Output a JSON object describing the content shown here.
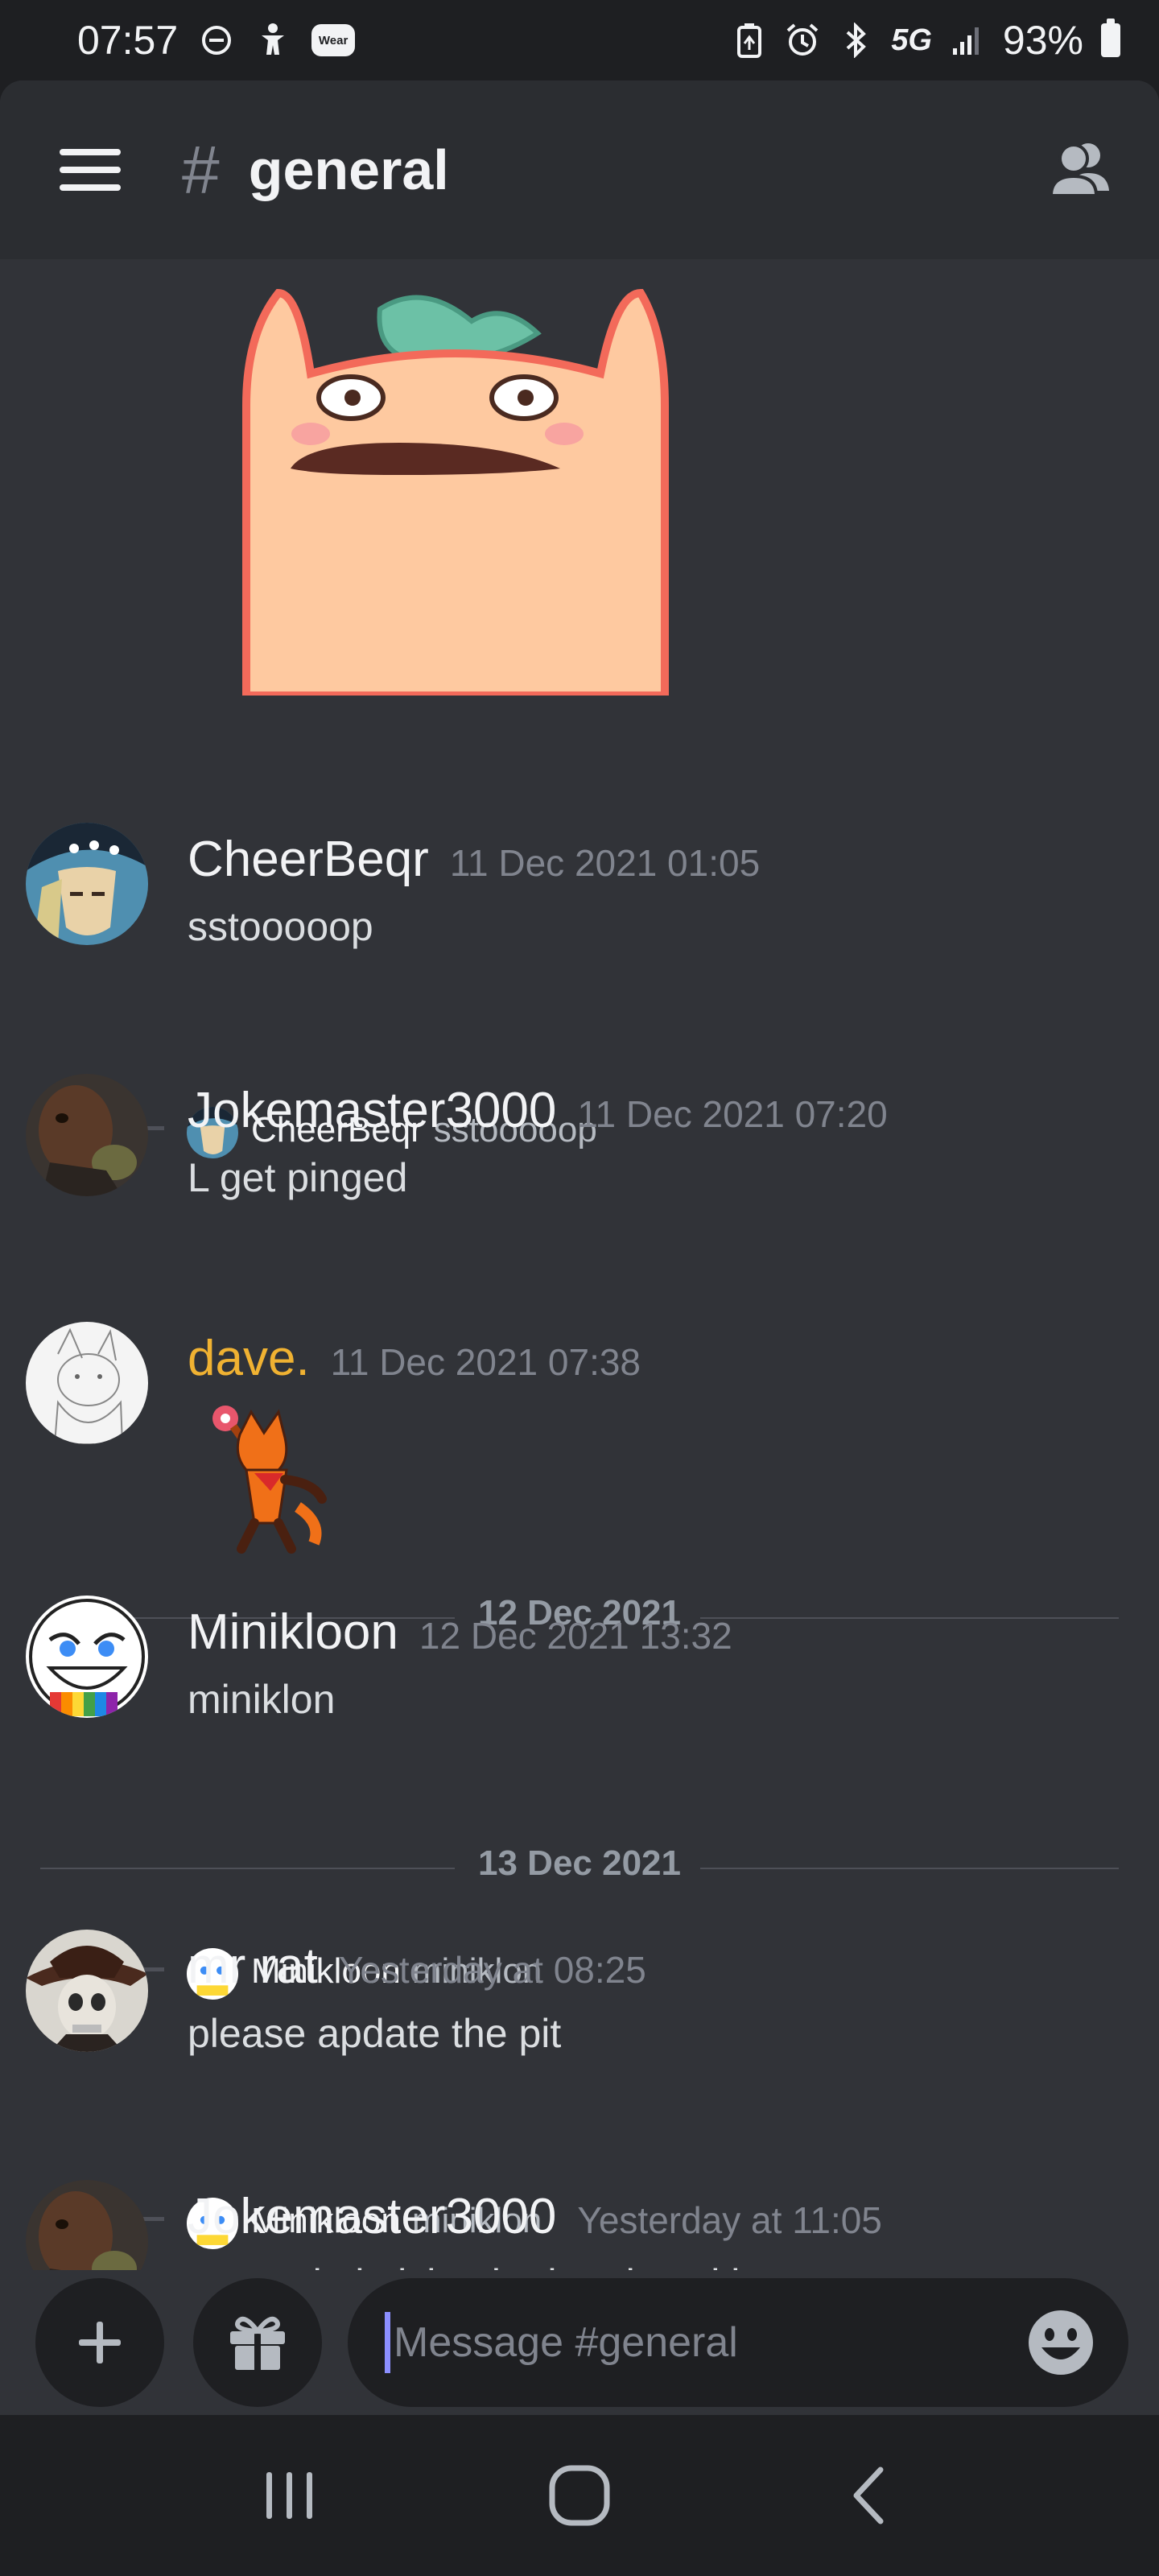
{
  "status_bar": {
    "time": "07:57",
    "wear_label": "Wear",
    "network": "5G",
    "battery": "93%",
    "icons": [
      "minus-circle-icon",
      "accessibility-icon",
      "wear-icon",
      "battery-saver-icon",
      "alarm-icon",
      "bluetooth-icon",
      "signal-icon",
      "battery-icon"
    ]
  },
  "header": {
    "hash": "#",
    "channel": "general",
    "menu_icon": "hamburger-menu-icon",
    "members_icon": "members-icon"
  },
  "messages": [
    {
      "username": "CheerBeqr",
      "timestamp": "11 Dec 2021 01:05",
      "text": "sstooooop",
      "name_color": "#f2f3f5"
    },
    {
      "reply": {
        "username": "CheerBeqr",
        "text": "sstooooop"
      },
      "username": "Jokemaster3000",
      "timestamp": "11 Dec 2021 07:20",
      "text": "L get pinged",
      "name_color": "#f2f3f5"
    },
    {
      "username": "dave.",
      "timestamp": "11 Dec 2021 07:38",
      "text": "",
      "name_color": "#f0b232",
      "attachment": "sticker"
    },
    {
      "username": "Minikloon",
      "timestamp": "12 Dec 2021 13:32",
      "text": "miniklon",
      "name_color": "#f2f3f5"
    },
    {
      "reply": {
        "username": "Minikloon",
        "text": "miniklon"
      },
      "username": "mr rat",
      "timestamp": "Yesterday at 08:25",
      "text": "please apdate the pit",
      "name_color": "#f2f3f5"
    },
    {
      "reply": {
        "username": "Minikloon",
        "text": "miniklon"
      },
      "username": "Jokemaster3000",
      "timestamp": "Yesterday at 11:05",
      "text": "omg rel nimiclon in da rel conklav",
      "name_color": "#f2f3f5"
    }
  ],
  "dividers": [
    "12 Dec 2021",
    "13 Dec 2021"
  ],
  "composer": {
    "placeholder": "Message #general",
    "add_icon": "plus-icon",
    "gift_icon": "gift-icon",
    "emoji_icon": "emoji-icon"
  },
  "navbar": {
    "icons": [
      "recents-icon",
      "home-icon",
      "back-icon"
    ]
  },
  "colors": {
    "background": "#313338",
    "header": "#2b2d31",
    "accent": "#8c8fff",
    "highlight_name": "#f0b232"
  }
}
